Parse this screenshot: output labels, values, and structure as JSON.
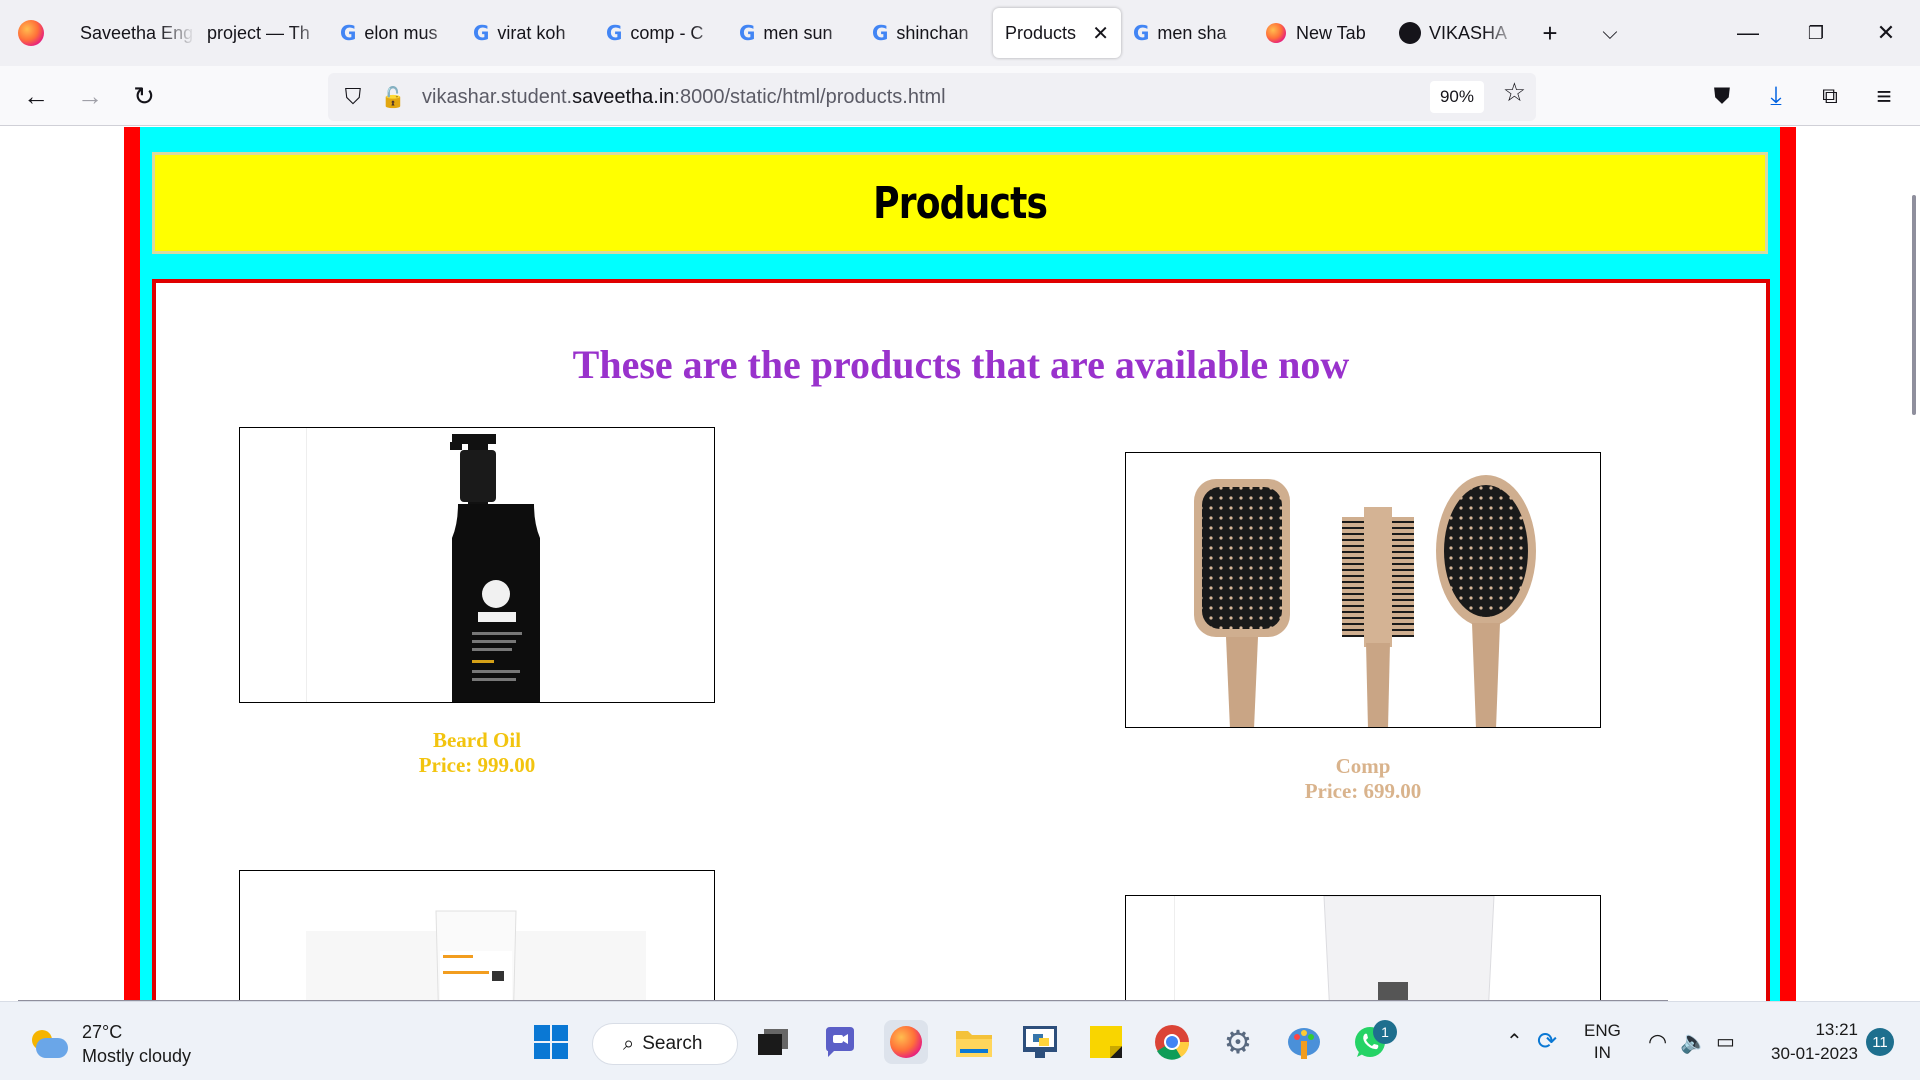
{
  "browser": {
    "tabs": [
      {
        "label": "Saveetha Eng",
        "icon": "firefox-favicon"
      },
      {
        "label": "project — Th",
        "icon": "none"
      },
      {
        "label": "elon mus",
        "icon": "google-icon"
      },
      {
        "label": "virat koh",
        "icon": "google-icon"
      },
      {
        "label": "comp - C",
        "icon": "google-icon"
      },
      {
        "label": "men sun",
        "icon": "google-icon"
      },
      {
        "label": "shinchan",
        "icon": "google-icon"
      },
      {
        "label": "Products",
        "icon": "none",
        "active": true
      },
      {
        "label": "men sha",
        "icon": "google-icon"
      },
      {
        "label": "New Tab",
        "icon": "firefox-icon"
      },
      {
        "label": "VIKASHA",
        "icon": "github-icon"
      }
    ],
    "url_prefix": "vikashar.student.",
    "url_domain": "saveetha.in",
    "url_suffix": ":8000/static/html/products.html",
    "zoom": "90%"
  },
  "page": {
    "header_title": "Products",
    "subtitle": "These are the products that are available now",
    "products": [
      {
        "name": "Beard Oil",
        "price": "Price: 999.00",
        "color": "#f2c40f"
      },
      {
        "name": "Comp",
        "price": "Price: 699.00",
        "color": "#d9b38c"
      }
    ]
  },
  "colors": {
    "outer_frame": "#ff0000",
    "inner_frame": "#00ffff",
    "header_bg": "#ffff00",
    "subtitle": "#9932cc"
  },
  "taskbar": {
    "temperature": "27°C",
    "weather": "Mostly cloudy",
    "search_label": "Search",
    "lang_top": "ENG",
    "lang_bottom": "IN",
    "time": "13:21",
    "date": "30-01-2023",
    "notifications": "11",
    "whatsapp_badge": "1"
  }
}
